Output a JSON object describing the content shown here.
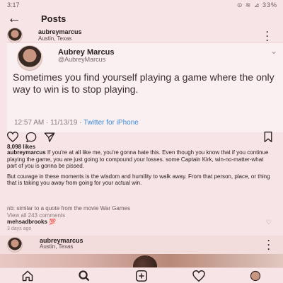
{
  "status": {
    "time": "3:17",
    "icons": "⊙ ≋ ⊿ 33%"
  },
  "topbar": {
    "title": "Posts"
  },
  "post": {
    "username": "aubreymarcus",
    "location": "Austin, Texas"
  },
  "tweet": {
    "name": "Aubrey Marcus",
    "handle": "@AubreyMarcus",
    "text": "Sometimes you find yourself playing a game where the only way to win is to stop playing.",
    "timestamp": "12:57 AM · 11/13/19 · ",
    "source": "Twitter for iPhone"
  },
  "likes": "8,098 likes",
  "caption": {
    "username": "aubreymarcus",
    "p1": " If you're at all like me, you're gonna hate this. Even though you know that if you continue playing the game, you are just going to compound your losses. some Captain Kirk, win-no-matter-what part of you is gonna be pissed.",
    "p2": "But courage in these moments is the wisdom and humility to walk away. From that person, place, or thing that is taking you away from going for your actual win.",
    "attribution": "nb: similar to a quote from the movie War Games"
  },
  "view_comments": "View all 243 comments",
  "comment": {
    "username": "mehsadbrooks",
    "text": " 💯"
  },
  "age": "3 days ago",
  "next_post": {
    "username": "aubreymarcus",
    "location": "Austin, Texas"
  },
  "colors": {
    "accent": "#3a8ad8",
    "heart": "#e0406a",
    "background": "#f7e4e6"
  }
}
